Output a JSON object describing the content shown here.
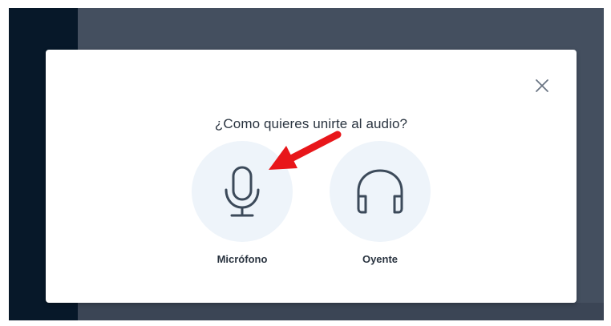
{
  "dialog": {
    "title": "¿Como quieres unirte al audio?",
    "close_icon": "close-icon",
    "options": [
      {
        "label": "Micrófono",
        "icon": "microphone-icon"
      },
      {
        "label": "Oyente",
        "icon": "headphones-icon"
      }
    ]
  },
  "colors": {
    "backdrop": "#444f5f",
    "sidebar": "#071829",
    "option_circle": "#eef4fa",
    "icon_stroke": "#3c4a5a",
    "annotation_arrow": "#e8161a"
  }
}
